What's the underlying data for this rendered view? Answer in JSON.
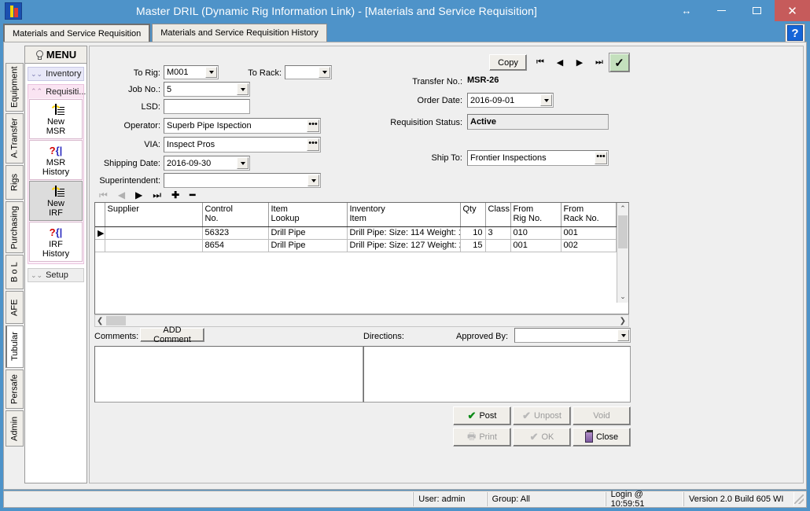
{
  "window": {
    "title": "Master DRIL (Dynamic Rig Information Link) - [Materials and Service Requisition]",
    "app_icon": "rig-icon",
    "controls": {
      "resize": "resize-icon",
      "minimize": "minimize-icon",
      "maximize": "maximize-icon",
      "close": "close-icon"
    }
  },
  "tabs": [
    {
      "label": "Materials and Service Requisition",
      "active": true
    },
    {
      "label": "Materials and Service Requisition History",
      "active": false
    }
  ],
  "help_button": {
    "label": "?"
  },
  "vertical_tabs": [
    {
      "label": "Equipment",
      "active": false
    },
    {
      "label": "A.Transfer",
      "active": false
    },
    {
      "label": "Rigs",
      "active": false
    },
    {
      "label": "Purchasing",
      "active": false
    },
    {
      "label": "B o L",
      "active": false
    },
    {
      "label": "AFE",
      "active": false
    },
    {
      "label": "Tubular",
      "active": true
    },
    {
      "label": "Persafe",
      "active": false
    },
    {
      "label": "Admin",
      "active": false
    }
  ],
  "menu": {
    "header": "MENU",
    "header_icon": "lightbulb-icon",
    "groups": [
      {
        "label": "Inventory",
        "icon": "chevron-double-down-icon",
        "expanded": false
      },
      {
        "label": "Requisiti...",
        "icon": "chevron-double-up-icon",
        "expanded": true
      },
      {
        "label": "Setup",
        "icon": "chevron-double-down-icon",
        "expanded": false
      }
    ],
    "items": [
      {
        "line1": "New",
        "line2": "MSR",
        "icon": "new-document-icon",
        "selected": false
      },
      {
        "line1": "MSR",
        "line2": "History",
        "icon": "history-query-icon",
        "selected": false
      },
      {
        "line1": "New",
        "line2": "IRF",
        "icon": "new-document-icon",
        "selected": true
      },
      {
        "line1": "IRF",
        "line2": "History",
        "icon": "history-query-icon",
        "selected": false
      }
    ]
  },
  "form": {
    "to_rig": {
      "label": "To Rig:",
      "value": "M001"
    },
    "to_rack": {
      "label": "To Rack:",
      "value": ""
    },
    "job_no": {
      "label": "Job No.:",
      "value": "5"
    },
    "lsd": {
      "label": "LSD:",
      "value": ""
    },
    "operator": {
      "label": "Operator:",
      "value": "Superb Pipe Ispection"
    },
    "via": {
      "label": "VIA:",
      "value": "Inspect Pros"
    },
    "shipping_date": {
      "label": "Shipping Date:",
      "value": "2016-09-30"
    },
    "superintendent": {
      "label": "Superintendent:",
      "value": ""
    },
    "transfer_no": {
      "label": "Transfer No.:",
      "value": "MSR-26"
    },
    "order_date": {
      "label": "Order Date:",
      "value": "2016-09-01"
    },
    "req_status": {
      "label": "Requisition Status:",
      "value": "Active"
    },
    "ship_to": {
      "label": "Ship To:",
      "value": "Frontier Inspections"
    }
  },
  "record_toolbar": {
    "copy_label": "Copy",
    "first": "first-record-icon",
    "prev": "previous-record-icon",
    "next": "next-record-icon",
    "last": "last-record-icon",
    "confirm": "confirm-checkmark-icon"
  },
  "grid_toolbar": [
    {
      "icon": "grid-first-icon",
      "disabled": true
    },
    {
      "icon": "grid-prev-icon",
      "disabled": true
    },
    {
      "icon": "grid-next-icon",
      "disabled": false
    },
    {
      "icon": "grid-last-icon",
      "disabled": false
    },
    {
      "icon": "grid-add-icon",
      "disabled": false
    },
    {
      "icon": "grid-delete-icon",
      "disabled": false
    }
  ],
  "grid": {
    "columns": [
      "Supplier",
      "Control\nNo.",
      "Item\nLookup",
      "Inventory\nItem",
      "Qty",
      "Class",
      "From\nRig No.",
      "From\nRack No."
    ],
    "columns_split": [
      {
        "l1": "Supplier",
        "l2": ""
      },
      {
        "l1": "Control",
        "l2": "No."
      },
      {
        "l1": "Item",
        "l2": "Lookup"
      },
      {
        "l1": "Inventory",
        "l2": "Item"
      },
      {
        "l1": "Qty",
        "l2": ""
      },
      {
        "l1": "Class",
        "l2": ""
      },
      {
        "l1": "From",
        "l2": "Rig No."
      },
      {
        "l1": "From",
        "l2": "Rack No."
      }
    ],
    "rows": [
      {
        "selected": true,
        "supplier": "",
        "control_no": "56323",
        "item_lookup": "Drill Pipe",
        "inventory_item": "Drill Pipe: Size: 114 Weight: 1",
        "qty": "10",
        "class": "3",
        "from_rig_no": "010",
        "from_rack_no": "001"
      },
      {
        "selected": false,
        "supplier": "",
        "control_no": "8654",
        "item_lookup": "Drill Pipe",
        "inventory_item": "Drill Pipe: Size: 127 Weight: 2",
        "qty": "15",
        "class": "",
        "from_rig_no": "001",
        "from_rack_no": "002"
      }
    ]
  },
  "comments": {
    "label": "Comments:",
    "add_button": "ADD Comment",
    "value": ""
  },
  "directions": {
    "label": "Directions:",
    "value": ""
  },
  "approved_by": {
    "label": "Approved By:",
    "value": ""
  },
  "action_buttons": [
    {
      "label": "Post",
      "icon": "green-check-icon",
      "disabled": false
    },
    {
      "label": "Unpost",
      "icon": "gray-check-icon",
      "disabled": true
    },
    {
      "label": "Void",
      "icon": "",
      "disabled": true
    },
    {
      "label": "Print",
      "icon": "printer-icon",
      "disabled": true
    },
    {
      "label": "OK",
      "icon": "gray-check-icon",
      "disabled": true
    },
    {
      "label": "Close",
      "icon": "exit-door-icon",
      "disabled": false
    }
  ],
  "statusbar": {
    "user": "User: admin",
    "group": "Group: All",
    "login": "Login @ 10:59:51",
    "version": "Version 2.0 Build 605 WI"
  },
  "colors": {
    "titlebar": "#4e93c9",
    "close_button": "#c65b5b",
    "confirm_green": "#c4e0bd",
    "selected_menu": "#dcdcdc",
    "requisition_group": "#fae4f2",
    "inventory_group": "#e8e8f8"
  }
}
